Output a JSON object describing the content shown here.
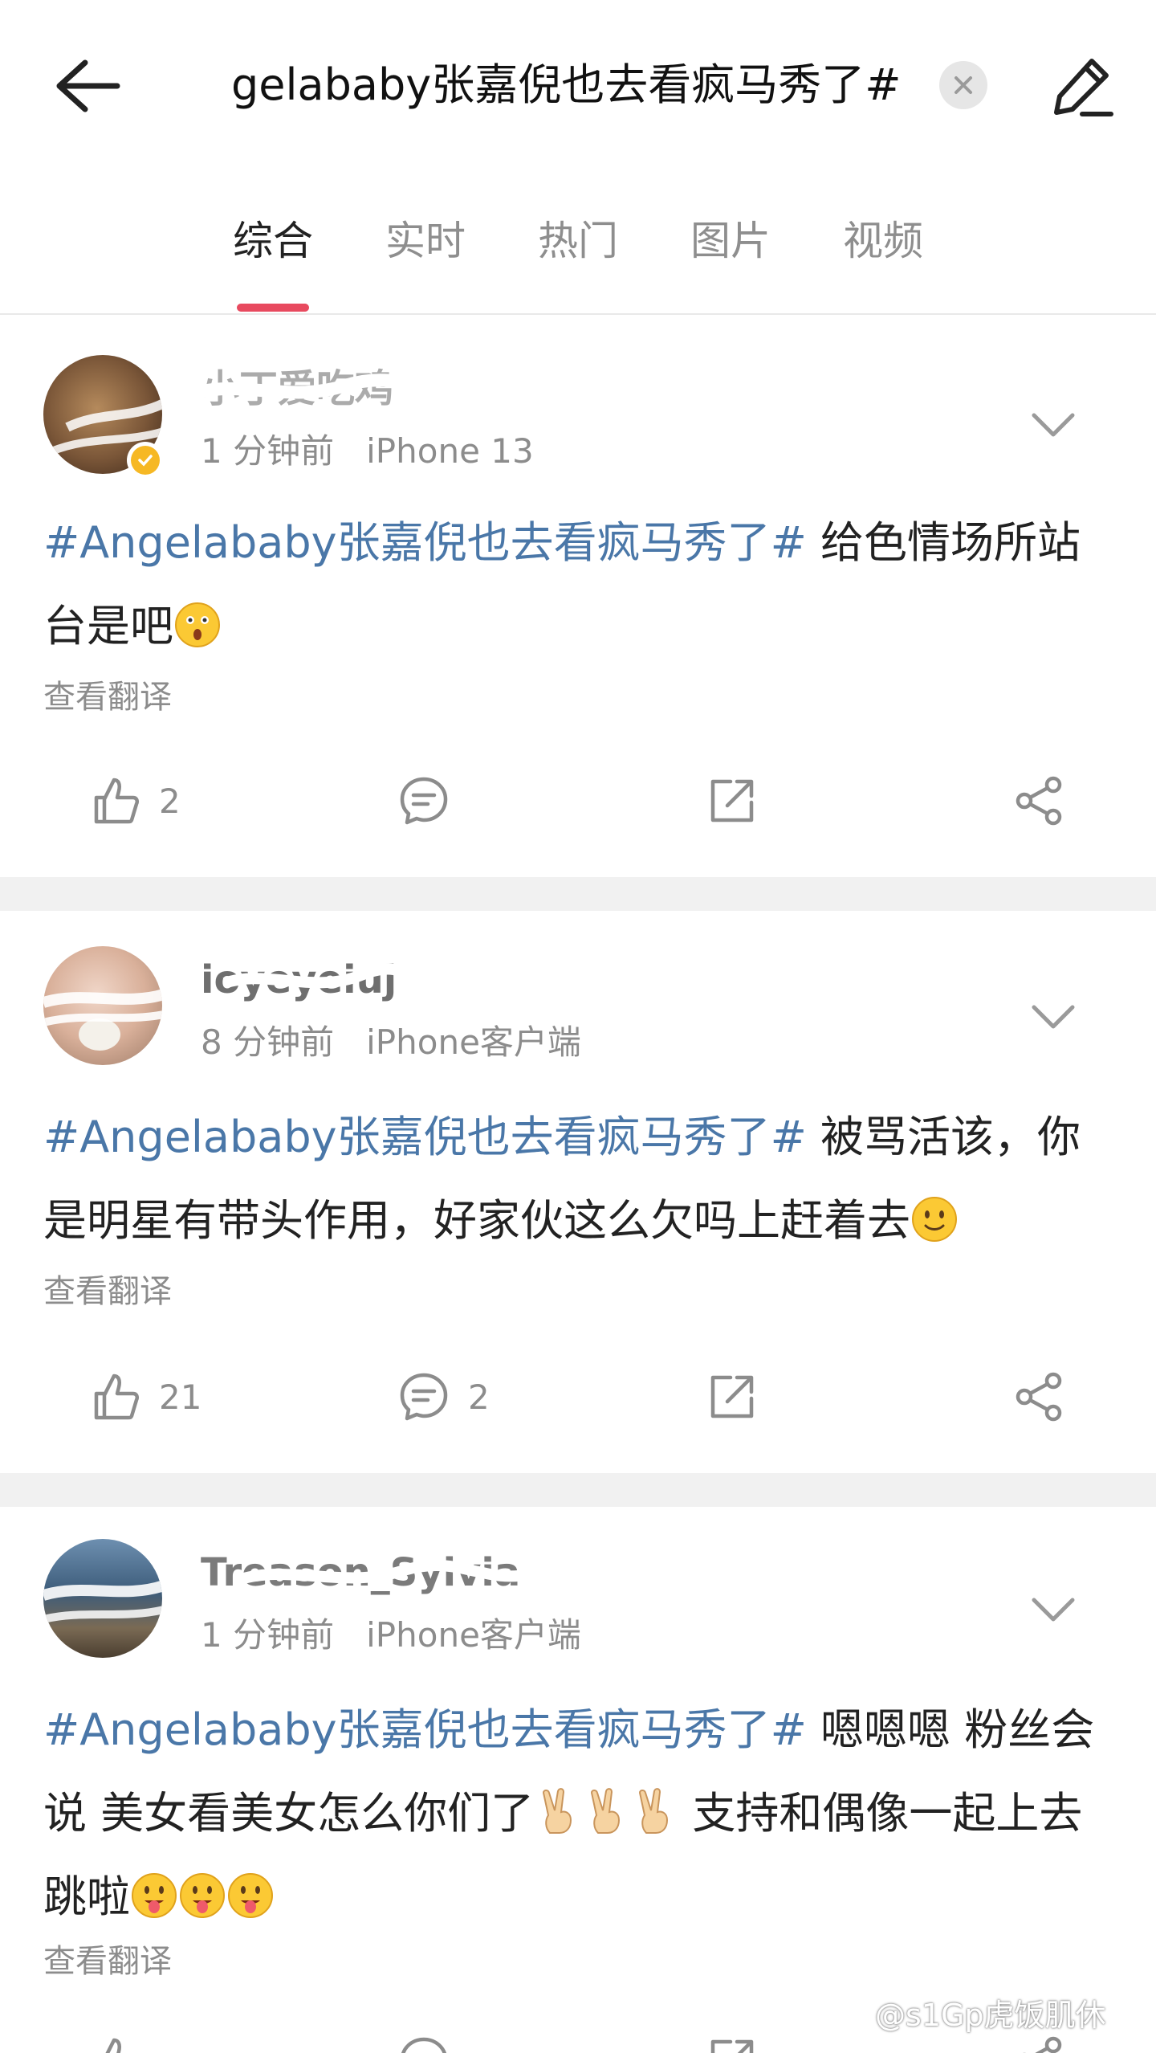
{
  "header": {
    "search_text": "gelababy张嘉倪也去看疯马秀了#",
    "tabs": [
      {
        "label": "综合",
        "active": true
      },
      {
        "label": "实时",
        "active": false
      },
      {
        "label": "热门",
        "active": false
      },
      {
        "label": "图片",
        "active": false
      },
      {
        "label": "视频",
        "active": false
      }
    ],
    "accent_color": "#e84a5f"
  },
  "posts": [
    {
      "username": "小丁爱吃鸡",
      "time": "1 分钟前",
      "device": "iPhone 13",
      "hashtag": "#Angelababy张嘉倪也去看疯马秀了#",
      "text": " 给色情场所站台是吧",
      "emoji": "astonished-face",
      "translate": "查看翻译",
      "likes": "2",
      "comments": "",
      "verified": true
    },
    {
      "username": "ioyeyeiuj",
      "time": "8 分钟前",
      "device": "iPhone客户端",
      "hashtag": "#Angelababy张嘉倪也去看疯马秀了#",
      "text": " 被骂活该，你是明星有带头作用，好家伙这么欠吗上赶着去",
      "emoji": "slight-smile-face",
      "translate": "查看翻译",
      "likes": "21",
      "comments": "2",
      "verified": false
    },
    {
      "username": "Treason_Sylvia",
      "time": "1 分钟前",
      "device": "iPhone客户端",
      "hashtag": "#Angelababy张嘉倪也去看疯马秀了#",
      "text": " 嗯嗯嗯 粉丝会说 美女看美女怎么你们了",
      "text2": " 支持和偶像一起上去跳啦",
      "emoji": "victory-hand",
      "emoji2": "tongue-face",
      "translate": "查看翻译",
      "likes": "",
      "comments": "",
      "verified": false
    }
  ],
  "watermark": "@s1Gp虎饭肌休"
}
